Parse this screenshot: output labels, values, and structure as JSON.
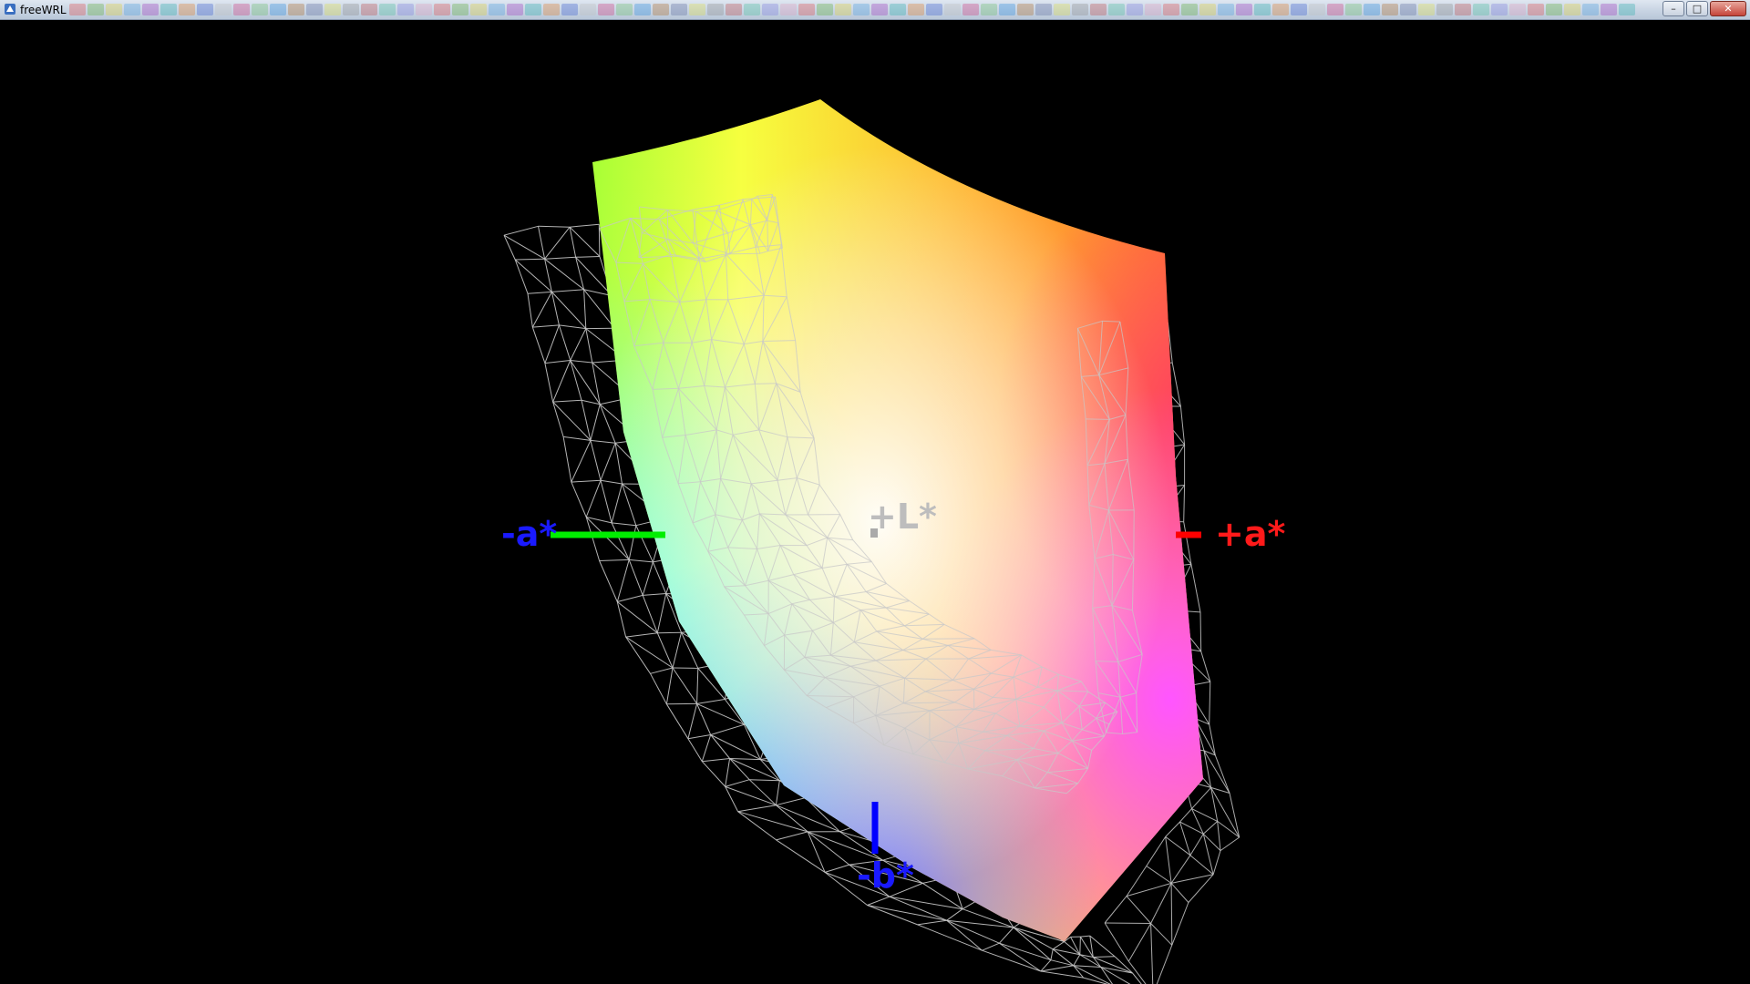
{
  "window": {
    "title": "freeWRL",
    "controls": {
      "minimize": "–",
      "maximize": "□",
      "close": "✕"
    }
  },
  "taskbar_strip_colors": [
    "#e05050",
    "#60b040",
    "#e0d040",
    "#50a0e0",
    "#a040c0",
    "#30b0b0",
    "#e08030",
    "#4060d0",
    "#c0c0c0",
    "#d04080",
    "#70c070",
    "#3090e0",
    "#b07030",
    "#6070a0",
    "#e0e050",
    "#909090",
    "#c05050",
    "#50c0a0",
    "#8080e0",
    "#e0a0c0"
  ],
  "viewport": {
    "labels": {
      "plus_L": "+L*",
      "minus_a": "-a*",
      "plus_a": "+a*",
      "minus_b": "-b*"
    },
    "colors": {
      "background": "#000000",
      "minus_a_label": "#1a1aff",
      "plus_a_label": "#ff1a1a",
      "minus_b_label": "#1a1aff",
      "plus_L_label": "#bdbdbd",
      "minus_a_axis": "#00ee00",
      "plus_a_axis": "#ff0000",
      "minus_b_axis": "#0000ff",
      "wireframe": "#c8c8c8"
    }
  }
}
